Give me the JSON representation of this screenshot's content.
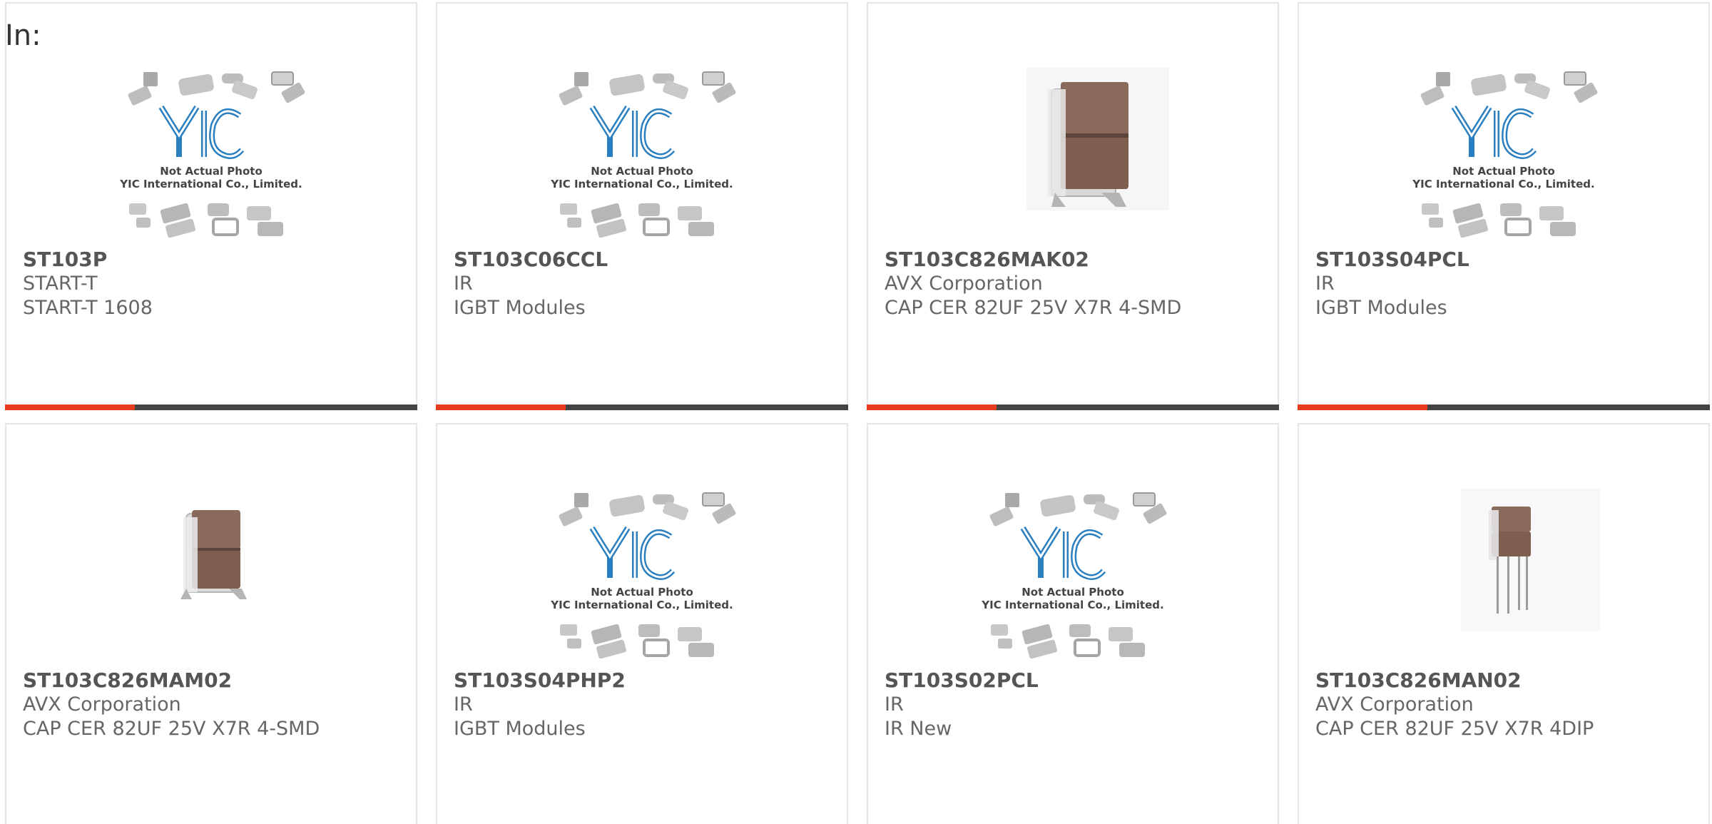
{
  "heading": "In:",
  "placeholder_caption": {
    "line1": "Not Actual Photo",
    "line2": "YIC International Co., Limited."
  },
  "colors": {
    "accent": "#e83a1c",
    "bar": "#444444",
    "logo_blue": "#2a7fc0"
  },
  "products": [
    {
      "part_number": "ST103P",
      "manufacturer": "START-T",
      "description": "START-T 1608",
      "image": "placeholder-logo"
    },
    {
      "part_number": "ST103C06CCL",
      "manufacturer": "IR",
      "description": "IGBT Modules",
      "image": "placeholder-logo"
    },
    {
      "part_number": "ST103C826MAK02",
      "manufacturer": "AVX Corporation",
      "description": "CAP CER 82UF 25V X7R 4-SMD",
      "image": "capacitor-smd-photo"
    },
    {
      "part_number": "ST103S04PCL",
      "manufacturer": "IR",
      "description": "IGBT Modules",
      "image": "placeholder-logo"
    },
    {
      "part_number": "ST103C826MAM02",
      "manufacturer": "AVX Corporation",
      "description": "CAP CER 82UF 25V X7R 4-SMD",
      "image": "capacitor-smd-photo"
    },
    {
      "part_number": "ST103S04PHP2",
      "manufacturer": "IR",
      "description": "IGBT Modules",
      "image": "placeholder-logo"
    },
    {
      "part_number": "ST103S02PCL",
      "manufacturer": "IR",
      "description": "IR New",
      "image": "placeholder-logo"
    },
    {
      "part_number": "ST103C826MAN02",
      "manufacturer": "AVX Corporation",
      "description": "CAP CER 82UF 25V X7R 4DIP",
      "image": "capacitor-dip-photo"
    }
  ]
}
